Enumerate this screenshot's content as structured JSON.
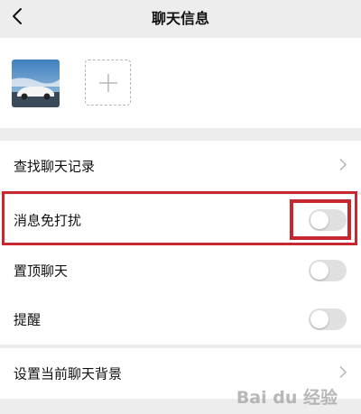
{
  "header": {
    "title": "聊天信息"
  },
  "rows": {
    "history": "查找聊天记录",
    "mute": "消息免打扰",
    "pin": "置顶聊天",
    "remind": "提醒",
    "background": "设置当前聊天背景"
  },
  "toggles": {
    "mute": false,
    "pin": false,
    "remind": false
  },
  "watermark": "Bai du 经验",
  "colors": {
    "highlight": "#c7272f",
    "toggle_off": "#e0e0e0"
  }
}
